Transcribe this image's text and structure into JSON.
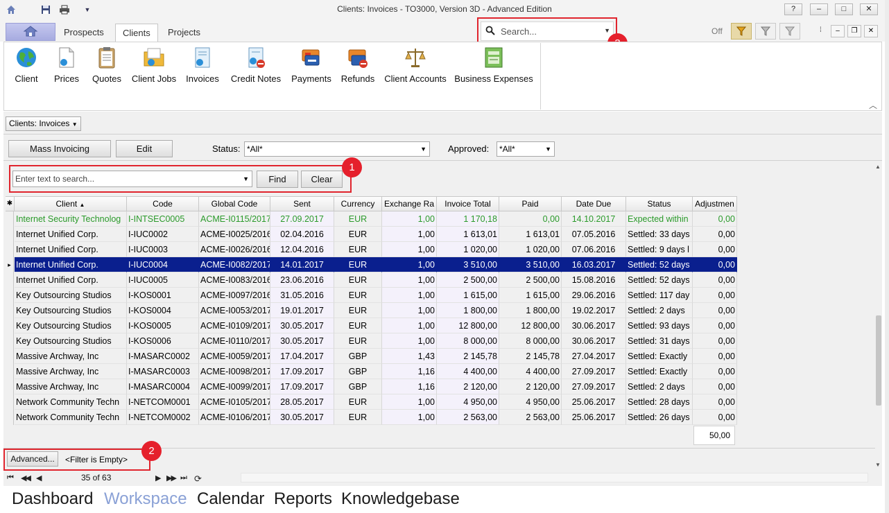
{
  "window": {
    "title": "Clients: Invoices - TO3000, Version 3D - Advanced Edition",
    "controls": [
      "?",
      "–",
      "□",
      "✕"
    ]
  },
  "ribbon_tabs": [
    {
      "label": "Prospects",
      "active": false
    },
    {
      "label": "Clients",
      "active": true
    },
    {
      "label": "Projects",
      "active": false
    }
  ],
  "global_search": {
    "placeholder": "Search...",
    "badge": "3"
  },
  "filter_toggle": {
    "state": "Off"
  },
  "ribbon_buttons": [
    {
      "label": "Client",
      "icon": "globe-icon"
    },
    {
      "label": "Prices",
      "icon": "document-icon"
    },
    {
      "label": "Quotes",
      "icon": "clipboard-icon"
    },
    {
      "label": "Client Jobs",
      "icon": "folder-icon"
    },
    {
      "label": "Invoices",
      "icon": "invoice-icon"
    },
    {
      "label": "Credit Notes",
      "icon": "credit-note-icon"
    },
    {
      "label": "Payments",
      "icon": "payment-card-icon"
    },
    {
      "label": "Refunds",
      "icon": "refund-card-icon"
    },
    {
      "label": "Client Accounts",
      "icon": "scales-icon"
    },
    {
      "label": "Business Expenses",
      "icon": "expenses-icon"
    }
  ],
  "breadcrumb": {
    "label": "Clients: Invoices"
  },
  "toolbar": {
    "mass_invoicing": "Mass Invoicing",
    "edit": "Edit",
    "status_label": "Status:",
    "status_value": "*All*",
    "approved_label": "Approved:",
    "approved_value": "*All*"
  },
  "find_panel": {
    "placeholder": "Enter text to search...",
    "find": "Find",
    "clear": "Clear",
    "badge": "1"
  },
  "grid": {
    "columns": [
      "Client",
      "Code",
      "Global Code",
      "Sent",
      "Currency",
      "Exchange Ra",
      "Invoice Total",
      "Paid",
      "Date Due",
      "Status",
      "Adjustmen"
    ],
    "rows": [
      {
        "client": "Internet Security Technolog",
        "code": "I-INTSEC0005",
        "global": "ACME-I0115/2017",
        "sent": "27.09.2017",
        "currency": "EUR",
        "rate": "1,00",
        "total": "1 170,18",
        "paid": "0,00",
        "due": "14.10.2017",
        "status": "Expected within",
        "adj": "0,00",
        "style": "green"
      },
      {
        "client": "Internet Unified Corp.",
        "code": "I-IUC0002",
        "global": "ACME-I0025/2016",
        "sent": "02.04.2016",
        "currency": "EUR",
        "rate": "1,00",
        "total": "1 613,01",
        "paid": "1 613,01",
        "due": "07.05.2016",
        "status": "Settled: 33 days",
        "adj": "0,00",
        "style": "normal"
      },
      {
        "client": "Internet Unified Corp.",
        "code": "I-IUC0003",
        "global": "ACME-I0026/2016",
        "sent": "12.04.2016",
        "currency": "EUR",
        "rate": "1,00",
        "total": "1 020,00",
        "paid": "1 020,00",
        "due": "07.06.2016",
        "status": "Settled: 9 days l",
        "adj": "0,00",
        "style": "normal"
      },
      {
        "client": "Internet Unified Corp.",
        "code": "I-IUC0004",
        "global": "ACME-I0082/2017",
        "sent": "14.01.2017",
        "currency": "EUR",
        "rate": "1,00",
        "total": "3 510,00",
        "paid": "3 510,00",
        "due": "16.03.2017",
        "status": "Settled: 52 days",
        "adj": "0,00",
        "style": "selected"
      },
      {
        "client": "Internet Unified Corp.",
        "code": "I-IUC0005",
        "global": "ACME-I0083/2016",
        "sent": "23.06.2016",
        "currency": "EUR",
        "rate": "1,00",
        "total": "2 500,00",
        "paid": "2 500,00",
        "due": "15.08.2016",
        "status": "Settled: 52 days",
        "adj": "0,00",
        "style": "normal"
      },
      {
        "client": "Key Outsourcing Studios",
        "code": "I-KOS0001",
        "global": "ACME-I0097/2016",
        "sent": "31.05.2016",
        "currency": "EUR",
        "rate": "1,00",
        "total": "1 615,00",
        "paid": "1 615,00",
        "due": "29.06.2016",
        "status": "Settled: 117 day",
        "adj": "0,00",
        "style": "normal"
      },
      {
        "client": "Key Outsourcing Studios",
        "code": "I-KOS0004",
        "global": "ACME-I0053/2017",
        "sent": "19.01.2017",
        "currency": "EUR",
        "rate": "1,00",
        "total": "1 800,00",
        "paid": "1 800,00",
        "due": "19.02.2017",
        "status": "Settled: 2 days",
        "adj": "0,00",
        "style": "normal"
      },
      {
        "client": "Key Outsourcing Studios",
        "code": "I-KOS0005",
        "global": "ACME-I0109/2017",
        "sent": "30.05.2017",
        "currency": "EUR",
        "rate": "1,00",
        "total": "12 800,00",
        "paid": "12 800,00",
        "due": "30.06.2017",
        "status": "Settled: 93 days",
        "adj": "0,00",
        "style": "normal"
      },
      {
        "client": "Key Outsourcing Studios",
        "code": "I-KOS0006",
        "global": "ACME-I0110/2017",
        "sent": "30.05.2017",
        "currency": "EUR",
        "rate": "1,00",
        "total": "8 000,00",
        "paid": "8 000,00",
        "due": "30.06.2017",
        "status": "Settled: 31 days",
        "adj": "0,00",
        "style": "normal"
      },
      {
        "client": "Massive Archway, Inc",
        "code": "I-MASARC0002",
        "global": "ACME-I0059/2017",
        "sent": "17.04.2017",
        "currency": "GBP",
        "rate": "1,43",
        "total": "2 145,78",
        "paid": "2 145,78",
        "due": "27.04.2017",
        "status": "Settled: Exactly",
        "adj": "0,00",
        "style": "normal"
      },
      {
        "client": "Massive Archway, Inc",
        "code": "I-MASARC0003",
        "global": "ACME-I0098/2017",
        "sent": "17.09.2017",
        "currency": "GBP",
        "rate": "1,16",
        "total": "4 400,00",
        "paid": "4 400,00",
        "due": "27.09.2017",
        "status": "Settled: Exactly",
        "adj": "0,00",
        "style": "normal"
      },
      {
        "client": "Massive Archway, Inc",
        "code": "I-MASARC0004",
        "global": "ACME-I0099/2017",
        "sent": "17.09.2017",
        "currency": "GBP",
        "rate": "1,16",
        "total": "2 120,00",
        "paid": "2 120,00",
        "due": "27.09.2017",
        "status": "Settled: 2 days",
        "adj": "0,00",
        "style": "normal"
      },
      {
        "client": "Network Community Techn",
        "code": "I-NETCOM0001",
        "global": "ACME-I0105/2017",
        "sent": "28.05.2017",
        "currency": "EUR",
        "rate": "1,00",
        "total": "4 950,00",
        "paid": "4 950,00",
        "due": "25.06.2017",
        "status": "Settled: 28 days",
        "adj": "0,00",
        "style": "normal"
      },
      {
        "client": "Network Community Techn",
        "code": "I-NETCOM0002",
        "global": "ACME-I0106/2017",
        "sent": "30.05.2017",
        "currency": "EUR",
        "rate": "1,00",
        "total": "2 563,00",
        "paid": "2 563,00",
        "due": "25.06.2017",
        "status": "Settled: 26 days",
        "adj": "0,00",
        "style": "normal"
      }
    ],
    "footer_total": "50,00"
  },
  "filter_panel": {
    "advanced": "Advanced...",
    "filter_text": "<Filter is Empty>",
    "badge": "2"
  },
  "navigator": {
    "position": "35 of 63"
  },
  "bottom_nav": [
    {
      "label": "Dashboard",
      "active": false
    },
    {
      "label": "Workspace",
      "active": true
    },
    {
      "label": "Calendar",
      "active": false
    },
    {
      "label": "Reports",
      "active": false
    },
    {
      "label": "Knowledgebase",
      "active": false
    }
  ],
  "colors": {
    "selected_row": "#0a1f8e",
    "green_row": "#2a9a2a",
    "annotation_red": "#e5202c",
    "active_nav": "#8aa1d6"
  }
}
